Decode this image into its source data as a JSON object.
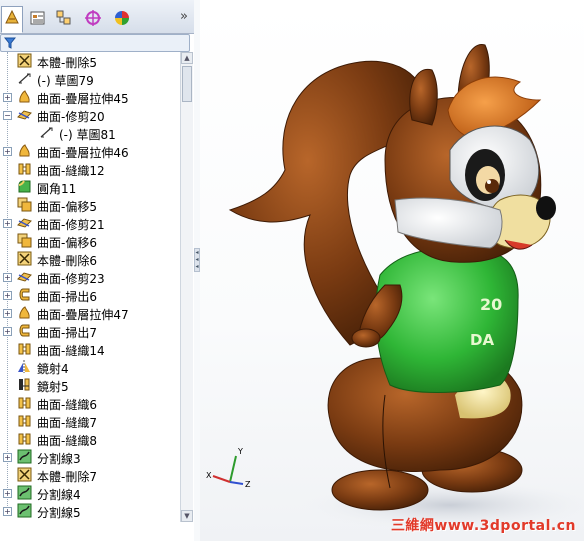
{
  "toolbar": {
    "tabs": [
      {
        "name": "feature-manager-tab",
        "icon": "feature-tree-icon",
        "active": true
      },
      {
        "name": "property-manager-tab",
        "icon": "property-icon",
        "active": false
      },
      {
        "name": "configuration-manager-tab",
        "icon": "configuration-icon",
        "active": false
      },
      {
        "name": "dimxpert-tab",
        "icon": "crosshair-icon",
        "active": false
      },
      {
        "name": "display-manager-tab",
        "icon": "color-wheel-icon",
        "active": false
      }
    ],
    "more_label": "»"
  },
  "filter": {
    "icon": "filter-icon"
  },
  "tree": {
    "items": [
      {
        "label": "本體-刪除5",
        "icon": "delete-body-icon",
        "expandable": false,
        "indent": 0
      },
      {
        "label": "(-) 草圖79",
        "icon": "sketch-icon",
        "expandable": false,
        "indent": 0
      },
      {
        "label": "曲面-疊層拉伸45",
        "icon": "loft-surface-icon",
        "expandable": true,
        "indent": 0
      },
      {
        "label": "曲面-修剪20",
        "icon": "trim-surface-icon",
        "expandable": true,
        "expanded": true,
        "indent": 0
      },
      {
        "label": "(-) 草圖81",
        "icon": "sketch-icon",
        "expandable": false,
        "indent": 1
      },
      {
        "label": "曲面-疊層拉伸46",
        "icon": "loft-surface-icon",
        "expandable": true,
        "indent": 0
      },
      {
        "label": "曲面-縫織12",
        "icon": "knit-surface-icon",
        "expandable": false,
        "indent": 0
      },
      {
        "label": "圓角11",
        "icon": "fillet-icon",
        "expandable": false,
        "indent": 0
      },
      {
        "label": "曲面-偏移5",
        "icon": "offset-surface-icon",
        "expandable": false,
        "indent": 0
      },
      {
        "label": "曲面-修剪21",
        "icon": "trim-surface-icon",
        "expandable": true,
        "indent": 0
      },
      {
        "label": "曲面-偏移6",
        "icon": "offset-surface-icon",
        "expandable": false,
        "indent": 0
      },
      {
        "label": "本體-刪除6",
        "icon": "delete-body-icon",
        "expandable": false,
        "indent": 0
      },
      {
        "label": "曲面-修剪23",
        "icon": "trim-surface-icon",
        "expandable": true,
        "indent": 0
      },
      {
        "label": "曲面-掃出6",
        "icon": "sweep-surface-icon",
        "expandable": true,
        "indent": 0
      },
      {
        "label": "曲面-疊層拉伸47",
        "icon": "loft-surface-icon",
        "expandable": true,
        "indent": 0
      },
      {
        "label": "曲面-掃出7",
        "icon": "sweep-surface-icon",
        "expandable": true,
        "indent": 0
      },
      {
        "label": "曲面-縫織14",
        "icon": "knit-surface-icon",
        "expandable": false,
        "indent": 0
      },
      {
        "label": "鏡射4",
        "icon": "mirror-icon",
        "expandable": false,
        "indent": 0
      },
      {
        "label": "鏡射5",
        "icon": "mirror-body-icon",
        "expandable": false,
        "indent": 0
      },
      {
        "label": "曲面-縫織6",
        "icon": "knit-surface-icon",
        "expandable": false,
        "indent": 0
      },
      {
        "label": "曲面-縫織7",
        "icon": "knit-surface-icon",
        "expandable": false,
        "indent": 0
      },
      {
        "label": "曲面-縫織8",
        "icon": "knit-surface-icon",
        "expandable": false,
        "indent": 0
      },
      {
        "label": "分割線3",
        "icon": "split-line-icon",
        "expandable": true,
        "indent": 0
      },
      {
        "label": "本體-刪除7",
        "icon": "delete-body-icon",
        "expandable": false,
        "indent": 0
      },
      {
        "label": "分割線4",
        "icon": "split-line-icon",
        "expandable": true,
        "indent": 0
      },
      {
        "label": "分割線5",
        "icon": "split-line-icon",
        "expandable": true,
        "indent": 0
      }
    ]
  },
  "viewport": {
    "model": "squirrel-model",
    "shirt_text": [
      "20",
      "DA"
    ],
    "triad_axes": [
      "X",
      "Y",
      "Z"
    ],
    "watermark": "三維網www.3dportal.cn"
  },
  "colors": {
    "fur": "#7a3b12",
    "fur_light": "#a8561e",
    "belly": "#f1e3a6",
    "shirt": "#34c23a",
    "hair": "#d8721f"
  }
}
